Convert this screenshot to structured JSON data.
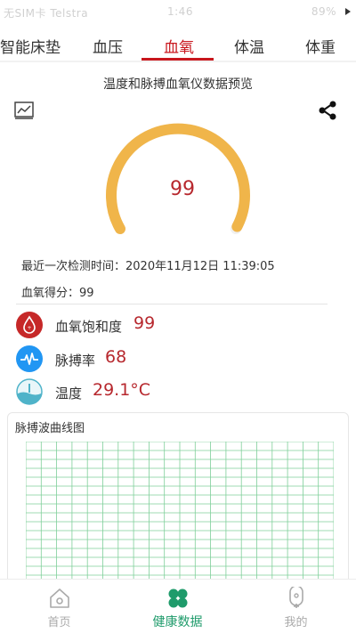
{
  "status_bar": {
    "left": "无SIM卡 Telstra",
    "time": "1:46",
    "right": "89%"
  },
  "tabs": [
    {
      "label": "智能床垫"
    },
    {
      "label": "血压"
    },
    {
      "label": "血氧",
      "active": true
    },
    {
      "label": "体温"
    },
    {
      "label": "体重"
    }
  ],
  "page": {
    "title": "温度和脉搏血氧仪数据预览"
  },
  "gauge": {
    "value": "99",
    "level_percent": 99,
    "track_color": "#f0f0f0",
    "arc_color": "#f0b54a"
  },
  "info": {
    "last_check": "最近一次检测时间：2020年11月12日 11:39:05",
    "score": "血氧得分：99"
  },
  "metrics": [
    {
      "label": "血氧饱和度",
      "value": "99",
      "icon": "blood-drop-icon",
      "icon_color": "#c62828"
    },
    {
      "label": "脉搏率",
      "value": "68",
      "icon": "heartbeat-icon",
      "icon_color": "#2196f3"
    },
    {
      "label": "温度",
      "value": "29.1°C",
      "icon": "thermometer-water-icon",
      "icon_color": "#4fb3c9"
    }
  ],
  "wave": {
    "title": "脉搏波曲线图",
    "grid_color": "#7fcf9a"
  },
  "bottom_nav": [
    {
      "label": "首页",
      "icon": "home-icon"
    },
    {
      "label": "健康数据",
      "icon": "clover-icon",
      "active": true
    },
    {
      "label": "我的",
      "icon": "profile-icon"
    }
  ],
  "accent_colors": {
    "tab_active": "#c8161d",
    "value_red": "#b7282e",
    "nav_active": "#1f9b6b"
  }
}
